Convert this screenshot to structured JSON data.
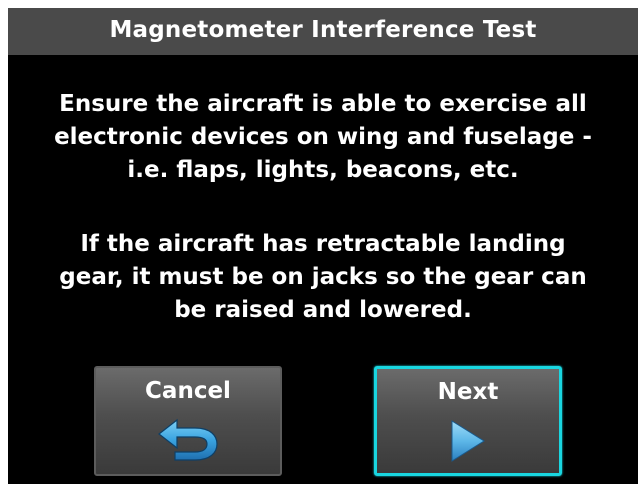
{
  "title": "Magnetometer Interference Test",
  "message_1": [
    "Ensure the aircraft is able to exercise all",
    "electronic devices on wing and fuselage -",
    "i.e. flaps, lights, beacons, etc."
  ],
  "message_2": [
    "If the aircraft has retractable landing",
    "gear, it must be on jacks so the gear can",
    "be raised and lowered."
  ],
  "buttons": {
    "cancel": {
      "label": "Cancel",
      "icon": "back-arrow-icon"
    },
    "next": {
      "label": "Next",
      "icon": "play-arrow-icon"
    }
  },
  "colors": {
    "background": "#000000",
    "title_bar": "#4a4a4a",
    "text": "#ffffff",
    "focus_border": "#19d6e0",
    "icon_blue": "#3aa3e0"
  }
}
